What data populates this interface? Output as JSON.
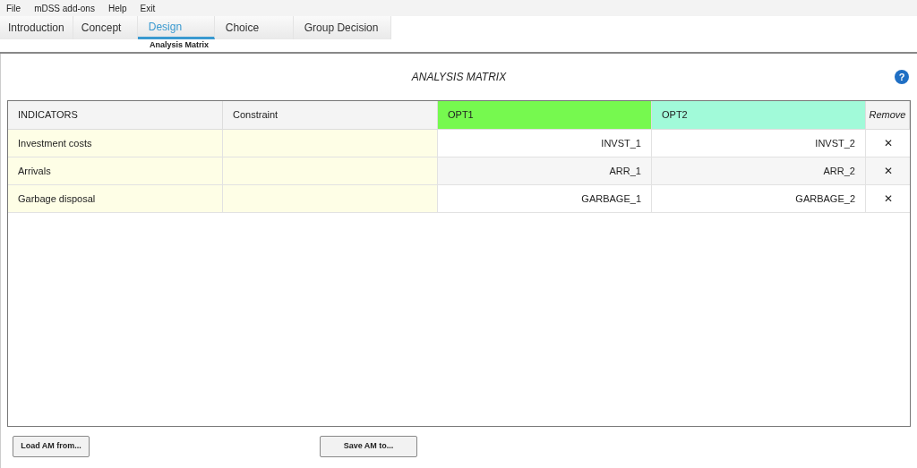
{
  "menu": [
    "File",
    "mDSS add-ons",
    "Help",
    "Exit"
  ],
  "tabs": [
    {
      "label": "Introduction",
      "selected": false
    },
    {
      "label": "Concept",
      "selected": false
    },
    {
      "label": "Design",
      "selected": true
    },
    {
      "label": "Choice",
      "selected": false
    },
    {
      "label": "Group Decision",
      "selected": false
    }
  ],
  "subtab": "Analysis Matrix",
  "title": "ANALYSIS MATRIX",
  "help_icon": "?",
  "table": {
    "columns": [
      {
        "label": "INDICATORS",
        "kind": "indicator"
      },
      {
        "label": "Constraint",
        "kind": "constraint"
      },
      {
        "label": "OPT1",
        "kind": "option",
        "color": "#76f94f"
      },
      {
        "label": "OPT2",
        "kind": "option",
        "color": "#a1fad9"
      },
      {
        "label": "Remove",
        "kind": "remove"
      }
    ],
    "rows": [
      {
        "cells": [
          "Investment costs",
          "",
          "INVST_1",
          "INVST_2",
          "✕"
        ]
      },
      {
        "cells": [
          "Arrivals",
          "",
          "ARR_1",
          "ARR_2",
          "✕"
        ]
      },
      {
        "cells": [
          "Garbage disposal",
          "",
          "GARBAGE_1",
          "GARBAGE_2",
          "✕"
        ]
      }
    ]
  },
  "buttons": [
    "Load AM from...",
    "Save AM to..."
  ]
}
